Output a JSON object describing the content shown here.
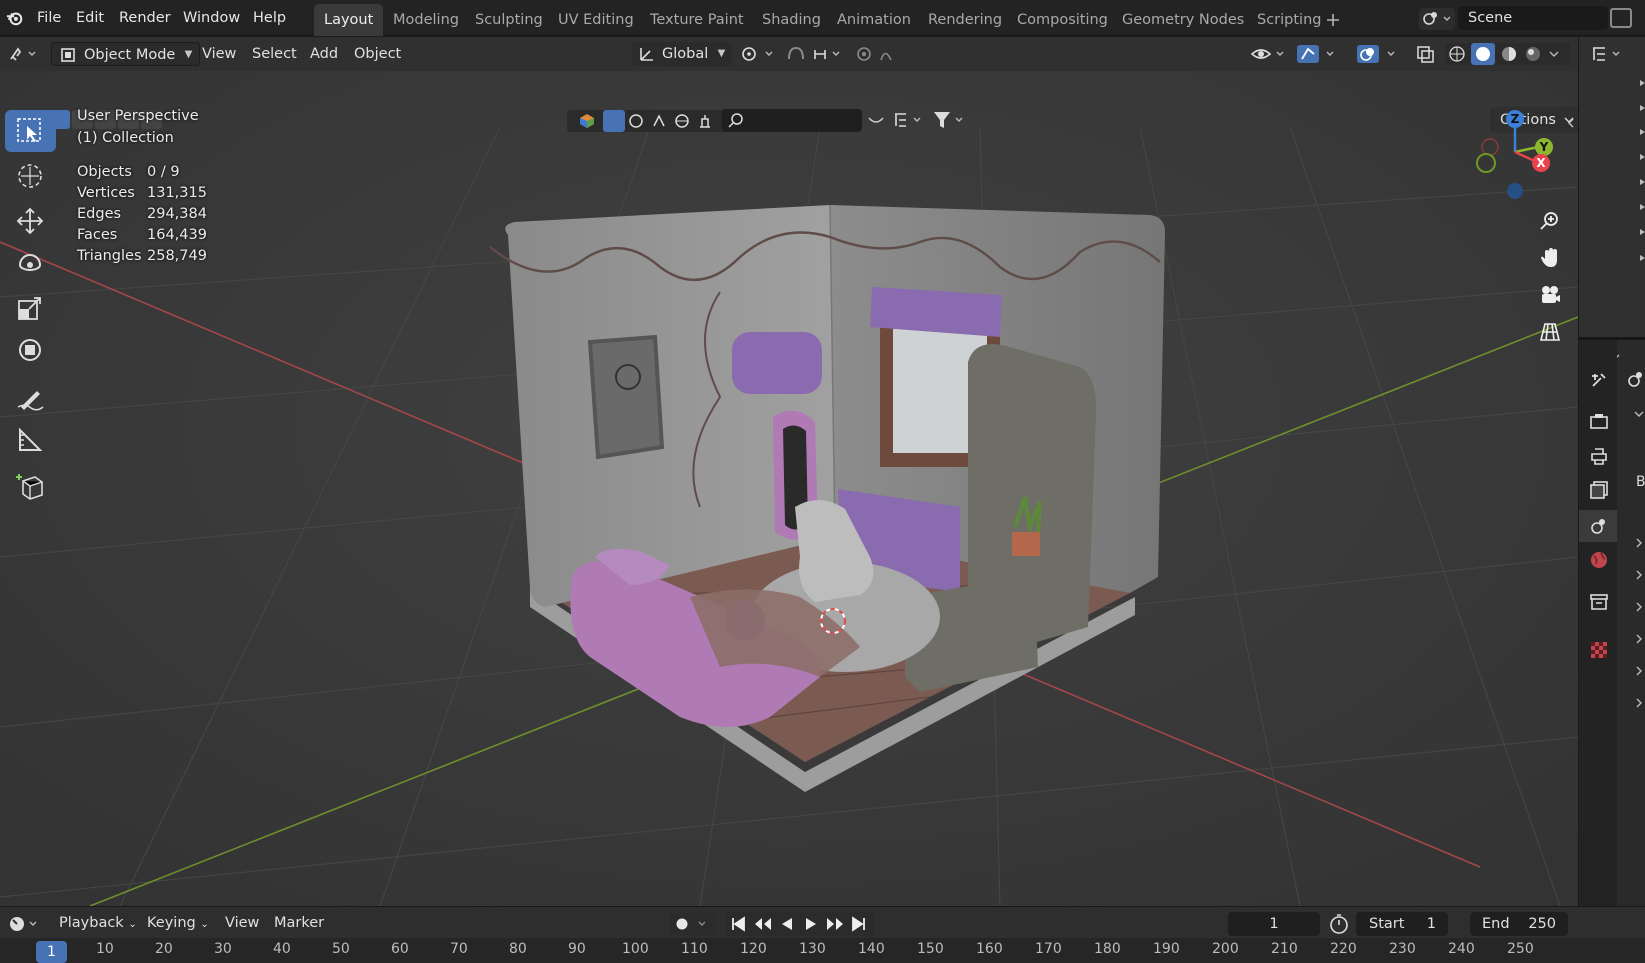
{
  "menu": {
    "logo_icon": "blender-logo-icon",
    "items": [
      "File",
      "Edit",
      "Render",
      "Window",
      "Help"
    ]
  },
  "workspaces": {
    "tabs": [
      "Layout",
      "Modeling",
      "Sculpting",
      "UV Editing",
      "Texture Paint",
      "Shading",
      "Animation",
      "Rendering",
      "Compositing",
      "Geometry Nodes",
      "Scripting"
    ],
    "active": "Layout",
    "add_icon": "plus-icon"
  },
  "scene": {
    "name": "Scene"
  },
  "viewport_header": {
    "mode": "Object Mode",
    "menus": [
      "View",
      "Select",
      "Add",
      "Object"
    ],
    "orientation": "Global"
  },
  "options_label": "Options",
  "overlay": {
    "view_name": "User Perspective",
    "collection": "(1) Collection",
    "stats": [
      {
        "label": "Objects",
        "value": "0 / 9"
      },
      {
        "label": "Vertices",
        "value": "131,315"
      },
      {
        "label": "Edges",
        "value": "294,384"
      },
      {
        "label": "Faces",
        "value": "164,439"
      },
      {
        "label": "Triangles",
        "value": "258,749"
      }
    ]
  },
  "gizmo": {
    "z": "Z",
    "y": "Y",
    "x": "X"
  },
  "colors": {
    "accent": "#4772b3",
    "axis_x": "#e8434a",
    "axis_y": "#8bb82e",
    "axis_z": "#3c7fd8",
    "viewport_bg": "#393939"
  },
  "timeline": {
    "menus": [
      "Playback",
      "Keying",
      "View",
      "Marker"
    ],
    "current_frame": "1",
    "start_label": "Start",
    "start_value": "1",
    "end_label": "End",
    "end_value": "250",
    "ruler_ticks": [
      "1",
      "10",
      "20",
      "30",
      "40",
      "50",
      "60",
      "70",
      "80",
      "90",
      "100",
      "110",
      "120",
      "130",
      "140",
      "150",
      "160",
      "170",
      "180",
      "190",
      "200",
      "210",
      "220",
      "230",
      "240",
      "250"
    ]
  },
  "properties_partial_label": "B"
}
